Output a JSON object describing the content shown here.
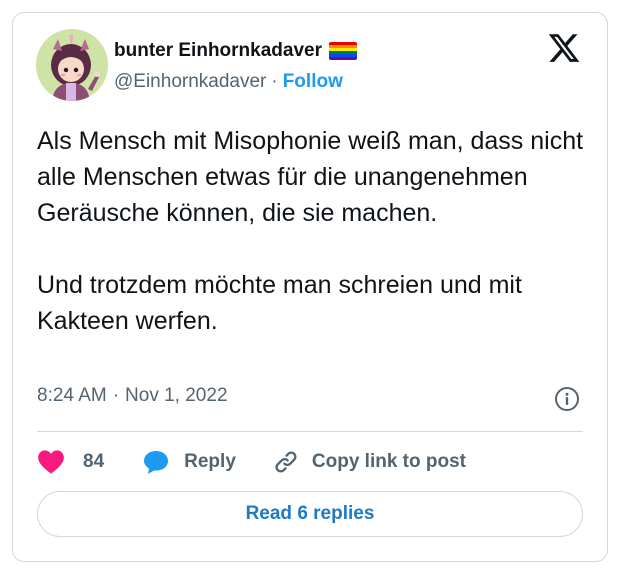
{
  "author": {
    "display_name": "bunter Einhornkadaver",
    "handle": "@Einhornkadaver",
    "separator": "·",
    "follow_label": "Follow",
    "avatar_icon": "avatar-unicorn-illustration",
    "flag_icon": "rainbow-flag-emoji"
  },
  "tweet": {
    "paragraphs": [
      "Als Mensch mit Misophonie weiß man, dass nicht alle Menschen etwas für die unangenehmen Geräusche können, die sie machen.",
      "Und trotzdem möchte man schreien und mit Kakteen werfen."
    ],
    "time": "8:24 AM",
    "meta_separator": "·",
    "date": "Nov 1, 2022"
  },
  "actions": {
    "like_count": "84",
    "reply_label": "Reply",
    "copy_link_label": "Copy link to post"
  },
  "read_replies_label": "Read 6 replies",
  "colors": {
    "accent": "#1d9bf0",
    "heart": "#f91880",
    "reply_bubble": "#1d9bf0",
    "text_primary": "#0f1419",
    "text_secondary": "#536471",
    "border": "#cfd9de"
  },
  "icons": {
    "platform": "x-logo-icon",
    "info": "info-icon",
    "like": "heart-icon",
    "reply": "reply-bubble-icon",
    "copy": "link-icon"
  }
}
